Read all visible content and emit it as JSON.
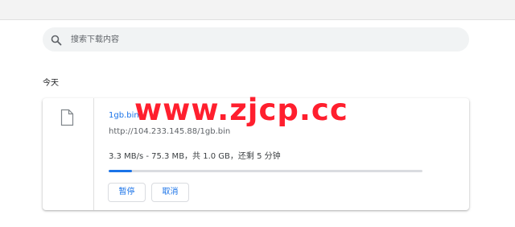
{
  "search": {
    "placeholder": "搜索下载内容",
    "icon": "search-icon"
  },
  "section": {
    "title": "今天"
  },
  "download": {
    "filename": "1gb.bin",
    "url": "http://104.233.145.88/1gb.bin",
    "progress_text": "3.3 MB/s - 75.3 MB，共 1.0 GB，还剩 5 分钟",
    "progress_fraction": 0.0735,
    "file_icon": "file-icon",
    "buttons": {
      "pause_label": "暂停",
      "cancel_label": "取消"
    }
  },
  "watermark": {
    "text": "www.zjcp.cc"
  },
  "colors": {
    "accent": "#1a73e8",
    "watermark": "#ff1f2e"
  }
}
